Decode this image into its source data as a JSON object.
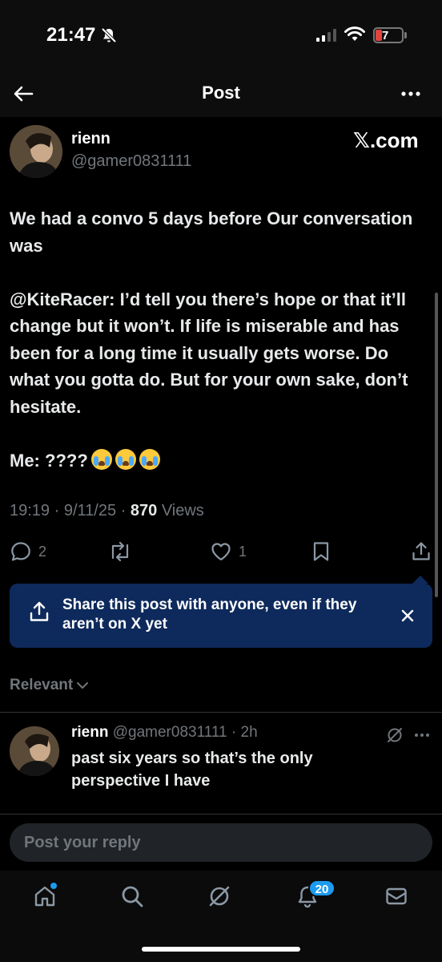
{
  "status_bar": {
    "time": "21:47",
    "battery": "7"
  },
  "header": {
    "title": "Post"
  },
  "post": {
    "author_name": "rienn",
    "author_handle": "@gamer0831111",
    "watermark": "𝕏.com",
    "paragraph_1": "We had a convo 5 days before Our conversation was",
    "paragraph_2": "@KiteRacer: I’d tell you there’s hope or that it’ll change but it won’t. If life is miserable and has been for a long time it usually gets worse. Do what you gotta do. But for your own sake, don’t hesitate.",
    "paragraph_3": "Me: ????",
    "time": "19:19",
    "date": "9/11/25",
    "views_count": "870",
    "views_label": "Views",
    "reply_count": "2",
    "like_count": "1"
  },
  "share_banner": {
    "text": "Share this post with anyone, even if they aren’t on X yet"
  },
  "sort": {
    "label": "Relevant"
  },
  "reply": {
    "name": "rienn",
    "handle": "@gamer0831111",
    "dot": "·",
    "time": "2h",
    "text": "past six years so that’s the only perspective I have"
  },
  "composer": {
    "placeholder": "Post your reply"
  },
  "tab_bar": {
    "notification_count": "20"
  },
  "colors": {
    "accent": "#1d9bf0",
    "banner_bg": "#0e2a5c",
    "muted": "#71767b"
  },
  "icons": [
    "back-arrow-icon",
    "more-icon",
    "reply-icon",
    "repost-icon",
    "like-icon",
    "bookmark-icon",
    "share-icon",
    "close-icon",
    "chevron-down-icon",
    "grok-icon",
    "home-icon",
    "search-icon",
    "bell-icon",
    "mail-icon"
  ]
}
